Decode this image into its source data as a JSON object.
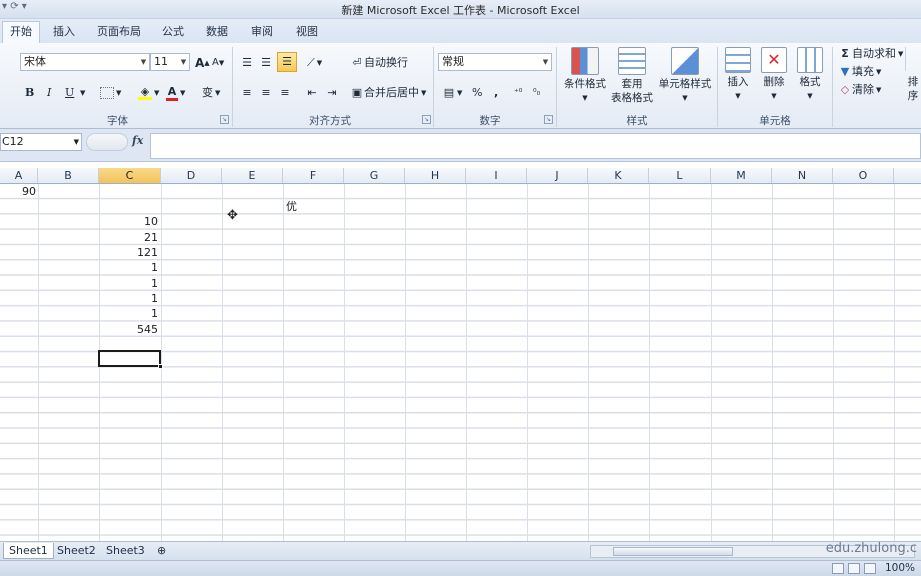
{
  "window": {
    "title": "新建 Microsoft Excel 工作表 - Microsoft Excel"
  },
  "ribbon_tabs": [
    "开始",
    "插入",
    "页面布局",
    "公式",
    "数据",
    "审阅",
    "视图"
  ],
  "font_group": {
    "font_name": "宋体",
    "font_size": "11",
    "bold": "B",
    "italic": "I",
    "underline": "U",
    "label": "字体",
    "grow": "A",
    "shrink": "A",
    "font_color_glyph": "A",
    "phonetic_glyph": "变"
  },
  "alignment_group": {
    "wrap_text": "自动换行",
    "merge_center": "合并后居中",
    "label": "对齐方式"
  },
  "number_group": {
    "format": "常规",
    "percent": "%",
    "comma": ",",
    "label": "数字"
  },
  "styles_group": {
    "conditional_format": "条件格式",
    "table_format_line1": "套用",
    "table_format_line2": "表格格式",
    "cell_styles": "单元格样式",
    "label": "样式"
  },
  "cells_group": {
    "insert": "插入",
    "delete": "删除",
    "format": "格式",
    "label": "单元格"
  },
  "editing_group": {
    "autosum": "自动求和",
    "fill": "填充",
    "clear": "清除",
    "sort": "排序"
  },
  "formula_bar": {
    "name_box": "C12",
    "fx": "fx",
    "value": ""
  },
  "columns": [
    "A",
    "B",
    "C",
    "D",
    "E",
    "F",
    "G",
    "H",
    "I",
    "J",
    "K",
    "L",
    "M",
    "N",
    "O"
  ],
  "selected_column": "C",
  "cells": {
    "A1": "90",
    "F2": "优",
    "C3": "10",
    "C4": "21",
    "C5": "121",
    "C6": "1",
    "C7": "1",
    "C8": "1",
    "C9": "1",
    "C10": "545"
  },
  "sheet_tabs": [
    "Sheet1",
    "Sheet2",
    "Sheet3"
  ],
  "active_sheet": "Sheet1",
  "status": {
    "zoom": "100%"
  },
  "watermark": "edu.zhulong.c",
  "colors": {
    "accent": "#f2c35a",
    "ribbon": "#e4ebf5",
    "grid": "#dadfe7"
  }
}
